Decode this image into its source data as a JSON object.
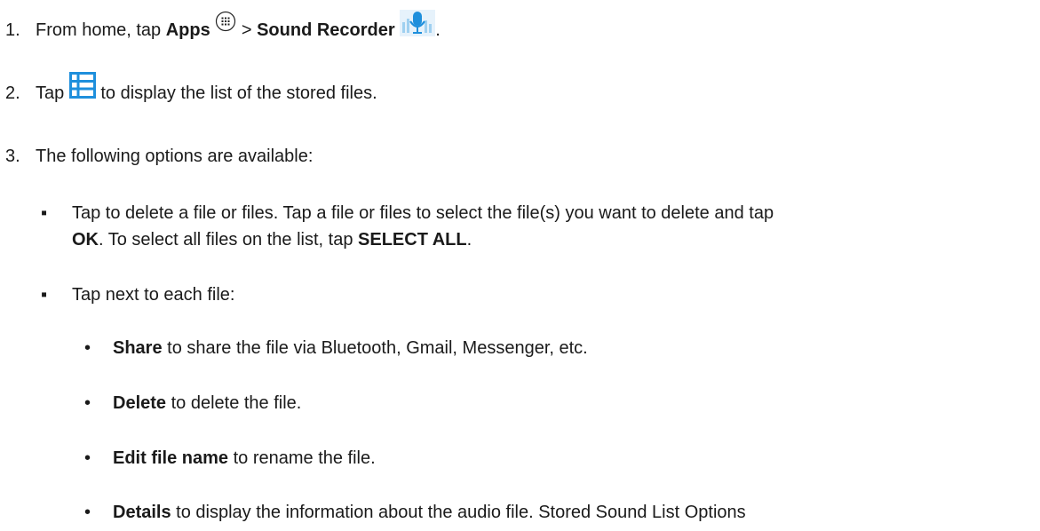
{
  "steps": [
    {
      "number": "1.",
      "pre": "From home, tap ",
      "apps": "Apps",
      "sep": " > ",
      "recorder": "Sound Recorder",
      "end": ".",
      "icons": [
        "apps-grid-icon",
        "sound-recorder-mic-icon"
      ]
    },
    {
      "number": "2.",
      "pre": "Tap ",
      "post": " to display the list of the stored files.",
      "icons": [
        "list-icon"
      ]
    },
    {
      "number": "3.",
      "text": "The following options are available:"
    }
  ],
  "options": {
    "delete_files": {
      "l1": "Tap to delete a file or files. Tap a file or files to select the file(s) you want to delete and tap",
      "ok": "OK",
      "mid": ". To select all files on the list, tap ",
      "select_all": "SELECT ALL",
      "end": "."
    },
    "per_file": {
      "text": "Tap next to each file:",
      "items": [
        {
          "term": "Share",
          "desc": " to share the file via Bluetooth, Gmail, Messenger, etc."
        },
        {
          "term": "Delete",
          "desc": " to delete the file."
        },
        {
          "term": "Edit file name",
          "desc": " to rename the file."
        },
        {
          "term": "Details",
          "desc": " to display the information about the audio file. Stored Sound List Options"
        }
      ]
    }
  },
  "bullets": {
    "square": "▪",
    "dot": "•"
  },
  "colors": {
    "text": "#1a1a1a",
    "icon_blue": "#1e8fdc"
  }
}
